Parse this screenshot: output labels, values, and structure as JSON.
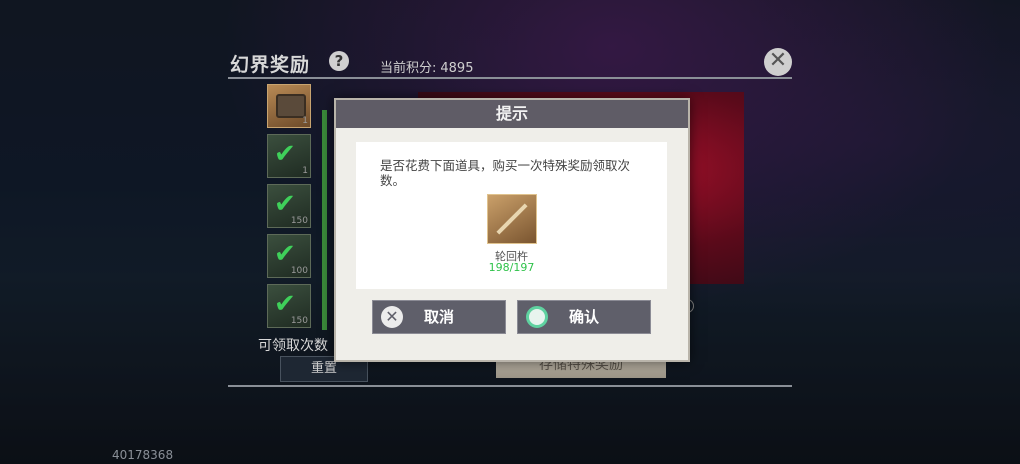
{
  "panel": {
    "title": "幻界奖励",
    "help_icon": "?",
    "score_label": "当前积分:",
    "score_value": "4895",
    "close_icon": "✕",
    "claim_label": "可领取次数",
    "reset_label": "重置",
    "store_label": "存储特殊奖励",
    "slots": [
      {
        "icon": "chest-icon",
        "count": "1"
      },
      {
        "icon": "check-icon",
        "count": "1"
      },
      {
        "icon": "check-icon",
        "count": "150"
      },
      {
        "icon": "check-icon",
        "count": "100"
      },
      {
        "icon": "check-icon",
        "count": "150"
      }
    ]
  },
  "dialog": {
    "title": "提示",
    "message": "是否花费下面道具，购买一次特殊奖励领取次数。",
    "item_name": "轮回杵",
    "item_count": "198/197",
    "cancel_label": "取消",
    "confirm_label": "确认"
  },
  "footer": {
    "uid": "40178368"
  },
  "colors": {
    "accent_green": "#2fc24a",
    "dialog_header": "#5f5c66",
    "button_bg": "#5f5f6a"
  }
}
